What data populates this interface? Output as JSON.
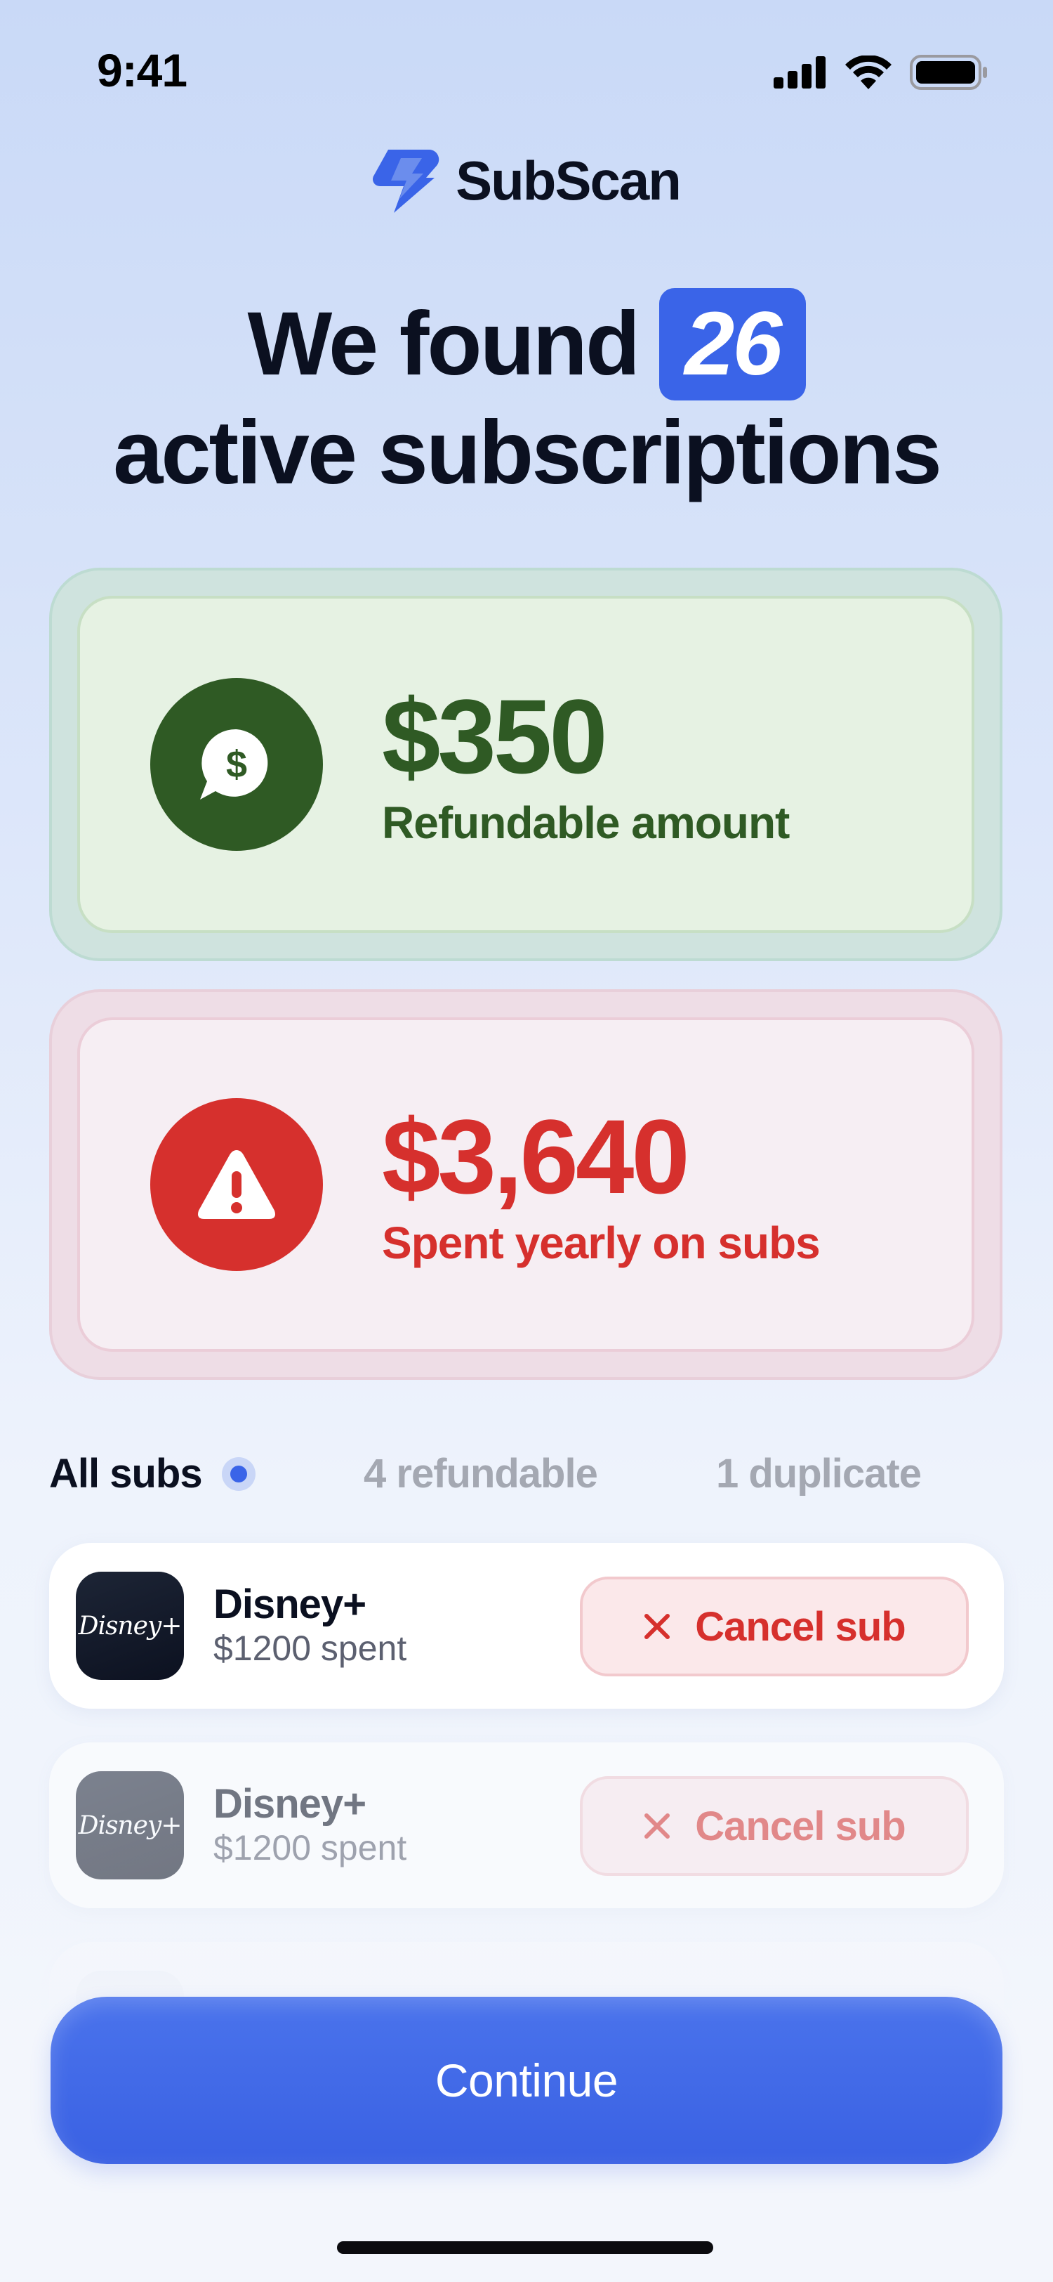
{
  "status_bar": {
    "time": "9:41"
  },
  "logo": {
    "name": "SubScan",
    "icon": "lightning-bolt-icon",
    "color": "#3a64e8"
  },
  "headline": {
    "prefix": "We found",
    "count": "26",
    "line2": "active subscriptions"
  },
  "stats": {
    "refundable": {
      "amount": "$350",
      "label": "Refundable amount",
      "icon": "dollar-chat-bubble-icon",
      "color": "#2f5a24"
    },
    "spent": {
      "amount": "$3,640",
      "label": "Spent yearly on subs",
      "icon": "warning-triangle-icon",
      "color": "#d6302d"
    }
  },
  "tabs": [
    {
      "label": "All subs",
      "selected": true
    },
    {
      "label": "4 refundable",
      "selected": false
    },
    {
      "label": "1 duplicate",
      "selected": false
    }
  ],
  "subs": [
    {
      "name": "Disney+",
      "spent": "$1200 spent",
      "logo_text": "Disney+",
      "cancel_label": "Cancel sub"
    },
    {
      "name": "Disney+",
      "spent": "$1200 spent",
      "logo_text": "Disney+",
      "cancel_label": "Cancel sub"
    }
  ],
  "continue_label": "Continue",
  "colors": {
    "accent": "#3a64e8",
    "danger": "#d6302d",
    "success": "#2f5a24"
  }
}
